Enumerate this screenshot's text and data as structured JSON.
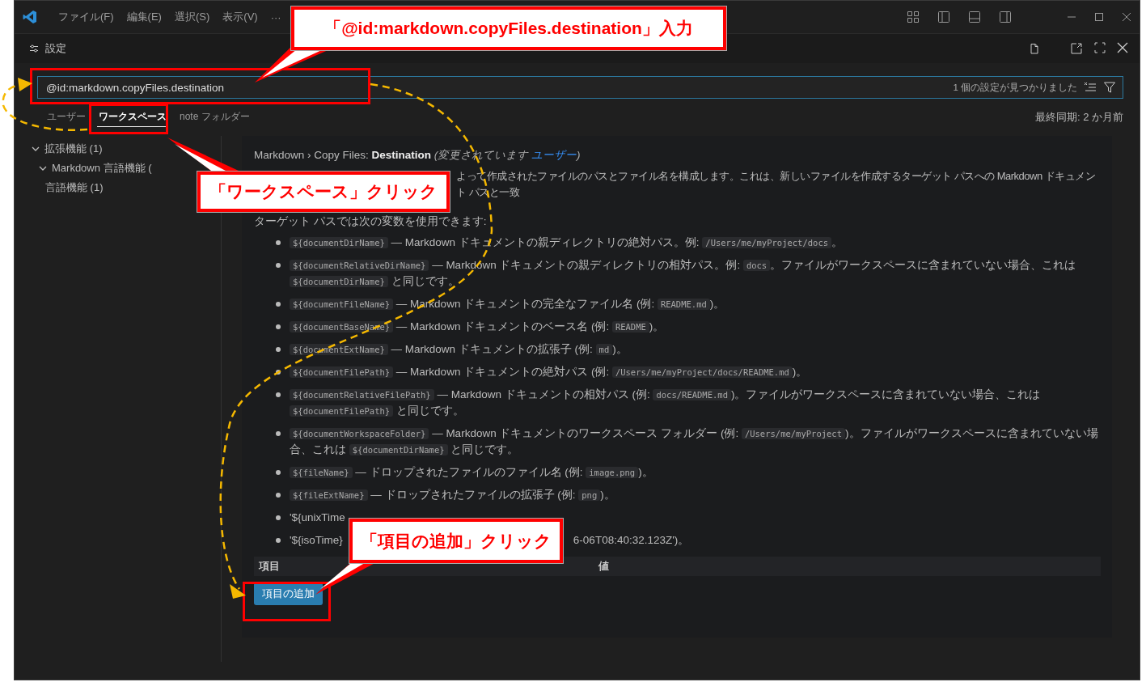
{
  "titlebar": {
    "menus": [
      "ファイル(F)",
      "編集(E)",
      "選択(S)",
      "表示(V)",
      "···"
    ]
  },
  "editor_tab": {
    "title": "設定"
  },
  "search": {
    "value": "@id:markdown.copyFiles.destination",
    "result_count": "1 個の設定が見つかりました"
  },
  "scope_tabs": [
    {
      "label": "ユーザー",
      "selected": false
    },
    {
      "label": "ワークスペース",
      "selected": true
    },
    {
      "label": "note",
      "suffix": "フォルダー",
      "selected": false
    }
  ],
  "sync_status": "最終同期: 2 か月前",
  "toc": [
    {
      "label": "拡張機能 (1)",
      "expanded": true,
      "children": [
        {
          "label": "Markdown 言語機能 (",
          "expanded": true,
          "children": [
            {
              "label": "言語機能 (1)"
            }
          ]
        }
      ]
    }
  ],
  "setting": {
    "category": "Markdown › Copy Files: ",
    "name": "Destination",
    "modified_note": "(変更されています ",
    "modified_link": "ユーザー",
    "modified_close": ")",
    "description": "よって作成されたファイルのパスとファイル名を構成します。これは、新しいファイルを作成するターゲット パスへの Markdown ドキュメント パスと一致",
    "variables_intro": "ターゲット パスでは次の変数を使用できます:",
    "variables": [
      {
        "parts": [
          {
            "kind": "code",
            "text": "${documentDirName}"
          },
          {
            "kind": "text",
            "text": " — Markdown ドキュメントの親ディレクトリの絶対パス。例: "
          },
          {
            "kind": "code",
            "text": "/Users/me/myProject/docs"
          },
          {
            "kind": "text",
            "text": "。"
          }
        ]
      },
      {
        "parts": [
          {
            "kind": "code",
            "text": "${documentRelativeDirName}"
          },
          {
            "kind": "text",
            "text": " — Markdown ドキュメントの親ディレクトリの相対パス。例: "
          },
          {
            "kind": "code",
            "text": "docs"
          },
          {
            "kind": "text",
            "text": "。ファイルがワークスペースに含まれていない場合、これは "
          },
          {
            "kind": "code",
            "text": "${documentDirName}"
          },
          {
            "kind": "text",
            "text": " と同じです。"
          }
        ]
      },
      {
        "parts": [
          {
            "kind": "code",
            "text": "${documentFileName}"
          },
          {
            "kind": "text",
            "text": " — Markdown ドキュメントの完全なファイル名 (例: "
          },
          {
            "kind": "code",
            "text": "README.md"
          },
          {
            "kind": "text",
            "text": ")。"
          }
        ]
      },
      {
        "parts": [
          {
            "kind": "code",
            "text": "${documentBaseName}"
          },
          {
            "kind": "text",
            "text": " — Markdown ドキュメントのベース名 (例: "
          },
          {
            "kind": "code",
            "text": "README"
          },
          {
            "kind": "text",
            "text": ")。"
          }
        ]
      },
      {
        "parts": [
          {
            "kind": "code",
            "text": "${documentExtName}"
          },
          {
            "kind": "text",
            "text": " — Markdown ドキュメントの拡張子 (例: "
          },
          {
            "kind": "code",
            "text": "md"
          },
          {
            "kind": "text",
            "text": ")。"
          }
        ]
      },
      {
        "parts": [
          {
            "kind": "code",
            "text": "${documentFilePath}"
          },
          {
            "kind": "text",
            "text": " — Markdown ドキュメントの絶対パス (例: "
          },
          {
            "kind": "code",
            "text": "/Users/me/myProject/docs/README.md"
          },
          {
            "kind": "text",
            "text": ")。"
          }
        ]
      },
      {
        "parts": [
          {
            "kind": "code",
            "text": "${documentRelativeFilePath}"
          },
          {
            "kind": "text",
            "text": " — Markdown ドキュメントの相対パス (例: "
          },
          {
            "kind": "code",
            "text": "docs/README.md"
          },
          {
            "kind": "text",
            "text": ")。ファイルがワークスペースに含まれていない場合、これは "
          },
          {
            "kind": "code",
            "text": "${documentFilePath}"
          },
          {
            "kind": "text",
            "text": " と同じです。"
          }
        ]
      },
      {
        "parts": [
          {
            "kind": "code",
            "text": "${documentWorkspaceFolder}"
          },
          {
            "kind": "text",
            "text": " — Markdown ドキュメントのワークスペース フォルダー (例: "
          },
          {
            "kind": "code",
            "text": "/Users/me/myProject"
          },
          {
            "kind": "text",
            "text": ")。ファイルがワークスペースに含まれていない場合、これは "
          },
          {
            "kind": "code",
            "text": "${documentDirName}"
          },
          {
            "kind": "text",
            "text": " と同じです。"
          }
        ]
      },
      {
        "parts": [
          {
            "kind": "code",
            "text": "${fileName}"
          },
          {
            "kind": "text",
            "text": " — ドロップされたファイルのファイル名 (例: "
          },
          {
            "kind": "code",
            "text": "image.png"
          },
          {
            "kind": "text",
            "text": ")。"
          }
        ]
      },
      {
        "parts": [
          {
            "kind": "code",
            "text": "${fileExtName}"
          },
          {
            "kind": "text",
            "text": " — ドロップされたファイルの拡張子 (例: "
          },
          {
            "kind": "code",
            "text": "png"
          },
          {
            "kind": "text",
            "text": ")。"
          }
        ]
      },
      {
        "parts": [
          {
            "kind": "text",
            "text": "'${unixTime"
          }
        ]
      },
      {
        "parts": [
          {
            "kind": "text",
            "text": "'${isoTime}"
          },
          {
            "kind": "covered"
          },
          {
            "kind": "text",
            "text": "6-06T08:40:32.123Z')。"
          }
        ]
      }
    ],
    "table": {
      "columns": [
        "項目",
        "値"
      ]
    },
    "add_button": "項目の追加"
  },
  "callouts": [
    {
      "text": "「@id:markdown.copyFiles.destination」入力"
    },
    {
      "text": "「ワークスペース」クリック"
    },
    {
      "text": "「項目の追加」クリック"
    }
  ]
}
